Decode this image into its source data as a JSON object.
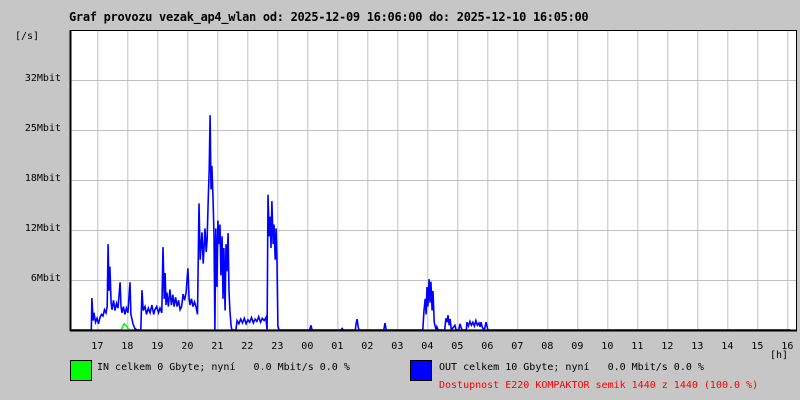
{
  "title": "Graf provozu vezak_ap4_wlan od: 2025-12-09 16:06:00 do: 2025-12-10 16:05:00",
  "legend": {
    "in_text": "IN celkem 0 Gbyte; nyní   0.0 Mbit/s 0.0 %",
    "out_text": "OUT celkem 10 Gbyte; nyní   0.0 Mbit/s 0.0 %",
    "availability": "Dostupnost E220 KOMPAKTOR semik 1440 z 1440 (100.0 %)"
  },
  "colors": {
    "in": "#00ff00",
    "out": "#0000ff",
    "grid": "#c0c0c0",
    "availability": "#ff0000",
    "background": "#c6c6c6",
    "plot": "#ffffff"
  },
  "chart_data": {
    "type": "line",
    "title": "Graf provozu vezak_ap4_wlan od: 2025-12-09 16:06:00 do: 2025-12-10 16:05:00",
    "xlabel": "[h]",
    "ylabel": "[/s]",
    "xlim": [
      16.1,
      40.1
    ],
    "ylim": [
      0,
      38.4
    ],
    "grid": true,
    "x_ticks": [
      {
        "value": 17,
        "label": "17"
      },
      {
        "value": 18,
        "label": "18"
      },
      {
        "value": 19,
        "label": "19"
      },
      {
        "value": 20,
        "label": "20"
      },
      {
        "value": 21,
        "label": "21"
      },
      {
        "value": 22,
        "label": "22"
      },
      {
        "value": 23,
        "label": "23"
      },
      {
        "value": 24,
        "label": "00"
      },
      {
        "value": 25,
        "label": "01"
      },
      {
        "value": 26,
        "label": "02"
      },
      {
        "value": 27,
        "label": "03"
      },
      {
        "value": 28,
        "label": "04"
      },
      {
        "value": 29,
        "label": "05"
      },
      {
        "value": 30,
        "label": "06"
      },
      {
        "value": 31,
        "label": "07"
      },
      {
        "value": 32,
        "label": "08"
      },
      {
        "value": 33,
        "label": "09"
      },
      {
        "value": 34,
        "label": "10"
      },
      {
        "value": 35,
        "label": "11"
      },
      {
        "value": 36,
        "label": "12"
      },
      {
        "value": 37,
        "label": "13"
      },
      {
        "value": 38,
        "label": "14"
      },
      {
        "value": 39,
        "label": "15"
      },
      {
        "value": 40,
        "label": "16"
      }
    ],
    "y_ticks": [
      {
        "value": 6.4,
        "label": "6Mbit"
      },
      {
        "value": 12.8,
        "label": "12Mbit"
      },
      {
        "value": 19.2,
        "label": "18Mbit"
      },
      {
        "value": 25.6,
        "label": "25Mbit"
      },
      {
        "value": 32,
        "label": "32Mbit"
      }
    ],
    "series": [
      {
        "name": "OUT",
        "color": "#0000ff",
        "points": [
          [
            16.1,
            0
          ],
          [
            16.8,
            0
          ],
          [
            16.82,
            4.1
          ],
          [
            16.86,
            1.2
          ],
          [
            16.89,
            2.2
          ],
          [
            16.94,
            1.0
          ],
          [
            16.99,
            1.5
          ],
          [
            17.04,
            0.8
          ],
          [
            17.09,
            1.6
          ],
          [
            17.14,
            2.0
          ],
          [
            17.19,
            1.8
          ],
          [
            17.24,
            2.6
          ],
          [
            17.29,
            2.2
          ],
          [
            17.33,
            3.0
          ],
          [
            17.36,
            11.0
          ],
          [
            17.39,
            5.0
          ],
          [
            17.42,
            8.1
          ],
          [
            17.46,
            3.5
          ],
          [
            17.49,
            2.6
          ],
          [
            17.54,
            3.8
          ],
          [
            17.59,
            2.5
          ],
          [
            17.64,
            3.4
          ],
          [
            17.69,
            2.8
          ],
          [
            17.76,
            6.1
          ],
          [
            17.79,
            3.0
          ],
          [
            17.82,
            2.2
          ],
          [
            17.87,
            3.0
          ],
          [
            17.92,
            2.0
          ],
          [
            17.97,
            2.8
          ],
          [
            18.02,
            2.2
          ],
          [
            18.09,
            6.1
          ],
          [
            18.12,
            2.0
          ],
          [
            18.19,
            0.8
          ],
          [
            18.25,
            0.2
          ],
          [
            18.32,
            0.0
          ],
          [
            18.45,
            0.0
          ],
          [
            18.49,
            5.1
          ],
          [
            18.53,
            2.5
          ],
          [
            18.59,
            3.0
          ],
          [
            18.64,
            2.0
          ],
          [
            18.7,
            2.8
          ],
          [
            18.76,
            2.2
          ],
          [
            18.82,
            3.2
          ],
          [
            18.88,
            2.0
          ],
          [
            18.92,
            2.6
          ],
          [
            18.98,
            3.0
          ],
          [
            19.04,
            2.2
          ],
          [
            19.09,
            2.8
          ],
          [
            19.15,
            2.2
          ],
          [
            19.19,
            10.6
          ],
          [
            19.23,
            4.0
          ],
          [
            19.26,
            7.3
          ],
          [
            19.29,
            3.2
          ],
          [
            19.32,
            4.8
          ],
          [
            19.37,
            3.0
          ],
          [
            19.42,
            5.2
          ],
          [
            19.47,
            3.2
          ],
          [
            19.52,
            4.5
          ],
          [
            19.56,
            3.0
          ],
          [
            19.61,
            4.2
          ],
          [
            19.66,
            3.0
          ],
          [
            19.71,
            3.8
          ],
          [
            19.76,
            2.6
          ],
          [
            19.81,
            3.0
          ],
          [
            19.86,
            4.6
          ],
          [
            19.91,
            3.8
          ],
          [
            19.96,
            4.8
          ],
          [
            20.02,
            7.9
          ],
          [
            20.06,
            4.0
          ],
          [
            20.09,
            3.2
          ],
          [
            20.14,
            4.0
          ],
          [
            20.19,
            3.0
          ],
          [
            20.24,
            3.6
          ],
          [
            20.29,
            3.0
          ],
          [
            20.34,
            2.0
          ],
          [
            20.39,
            16.2
          ],
          [
            20.43,
            9.0
          ],
          [
            20.49,
            12.5
          ],
          [
            20.53,
            8.5
          ],
          [
            20.59,
            13.0
          ],
          [
            20.63,
            10.0
          ],
          [
            20.66,
            11.5
          ],
          [
            20.7,
            17.0
          ],
          [
            20.73,
            20.5
          ],
          [
            20.76,
            27.5
          ],
          [
            20.79,
            18.0
          ],
          [
            20.82,
            21.0
          ],
          [
            20.86,
            16.6
          ],
          [
            20.89,
            12.0
          ],
          [
            20.92,
            0.0
          ],
          [
            20.95,
            13.0
          ],
          [
            20.99,
            5.5
          ],
          [
            21.02,
            14.0
          ],
          [
            21.06,
            11.0
          ],
          [
            21.09,
            13.5
          ],
          [
            21.12,
            7.0
          ],
          [
            21.16,
            12.0
          ],
          [
            21.19,
            4.0
          ],
          [
            21.22,
            10.5
          ],
          [
            21.26,
            2.5
          ],
          [
            21.29,
            11.0
          ],
          [
            21.32,
            7.5
          ],
          [
            21.36,
            12.4
          ],
          [
            21.39,
            5.0
          ],
          [
            21.42,
            2.5
          ],
          [
            21.46,
            0.5
          ],
          [
            21.49,
            0.0
          ],
          [
            21.62,
            0.0
          ],
          [
            21.66,
            1.2
          ],
          [
            21.72,
            0.8
          ],
          [
            21.78,
            1.4
          ],
          [
            21.84,
            0.9
          ],
          [
            21.9,
            1.5
          ],
          [
            21.96,
            0.8
          ],
          [
            22.02,
            1.3
          ],
          [
            22.08,
            1.0
          ],
          [
            22.14,
            1.6
          ],
          [
            22.2,
            0.9
          ],
          [
            22.26,
            1.4
          ],
          [
            22.32,
            1.1
          ],
          [
            22.38,
            1.7
          ],
          [
            22.44,
            1.0
          ],
          [
            22.5,
            1.5
          ],
          [
            22.56,
            1.2
          ],
          [
            22.62,
            1.6
          ],
          [
            22.66,
            0.0
          ],
          [
            22.69,
            17.3
          ],
          [
            22.73,
            12.0
          ],
          [
            22.76,
            14.5
          ],
          [
            22.79,
            10.5
          ],
          [
            22.82,
            16.5
          ],
          [
            22.86,
            11.0
          ],
          [
            22.89,
            13.5
          ],
          [
            22.93,
            9.0
          ],
          [
            22.96,
            13.0
          ],
          [
            22.99,
            8.5
          ],
          [
            23.02,
            0.5
          ],
          [
            23.06,
            0.0
          ],
          [
            24.08,
            0.0
          ],
          [
            24.12,
            0.6
          ],
          [
            24.16,
            0.0
          ],
          [
            25.12,
            0.0
          ],
          [
            25.16,
            0.2
          ],
          [
            25.2,
            0.0
          ],
          [
            25.6,
            0.0
          ],
          [
            25.63,
            0.9
          ],
          [
            25.66,
            1.4
          ],
          [
            25.7,
            0.3
          ],
          [
            25.73,
            0.0
          ],
          [
            26.55,
            0.0
          ],
          [
            26.59,
            0.9
          ],
          [
            26.63,
            0.0
          ],
          [
            27.85,
            0.0
          ],
          [
            27.89,
            2.5
          ],
          [
            27.93,
            4.0
          ],
          [
            27.96,
            2.0
          ],
          [
            27.99,
            5.5
          ],
          [
            28.02,
            3.0
          ],
          [
            28.06,
            6.5
          ],
          [
            28.09,
            3.5
          ],
          [
            28.12,
            6.2
          ],
          [
            28.16,
            2.5
          ],
          [
            28.19,
            5.0
          ],
          [
            28.23,
            1.0
          ],
          [
            28.26,
            0.5
          ],
          [
            28.3,
            0.0
          ],
          [
            28.32,
            0.4
          ],
          [
            28.36,
            0.0
          ],
          [
            28.58,
            0.0
          ],
          [
            28.62,
            1.5
          ],
          [
            28.66,
            1.0
          ],
          [
            28.69,
            1.9
          ],
          [
            28.73,
            0.6
          ],
          [
            28.76,
            1.4
          ],
          [
            28.8,
            0.0
          ],
          [
            28.92,
            0.6
          ],
          [
            28.96,
            0.0
          ],
          [
            29.05,
            0.0
          ],
          [
            29.09,
            0.8
          ],
          [
            29.13,
            0.3
          ],
          [
            29.16,
            0.0
          ],
          [
            29.3,
            0.0
          ],
          [
            29.32,
            1.0
          ],
          [
            29.37,
            0.5
          ],
          [
            29.42,
            1.1
          ],
          [
            29.47,
            0.6
          ],
          [
            29.52,
            1.0
          ],
          [
            29.57,
            0.5
          ],
          [
            29.62,
            1.2
          ],
          [
            29.67,
            0.6
          ],
          [
            29.72,
            0.9
          ],
          [
            29.76,
            0.4
          ],
          [
            29.79,
            1.0
          ],
          [
            29.84,
            0.3
          ],
          [
            29.9,
            0.0
          ],
          [
            29.96,
            1.0
          ],
          [
            30.02,
            0.0
          ],
          [
            40.1,
            0.0
          ]
        ]
      },
      {
        "name": "IN",
        "color": "#00ff00",
        "points": [
          [
            16.1,
            0
          ],
          [
            17.8,
            0
          ],
          [
            17.85,
            0.5
          ],
          [
            17.9,
            0.8
          ],
          [
            17.95,
            0.6
          ],
          [
            18.0,
            0.4
          ],
          [
            18.05,
            0
          ],
          [
            40.1,
            0
          ]
        ]
      }
    ]
  }
}
